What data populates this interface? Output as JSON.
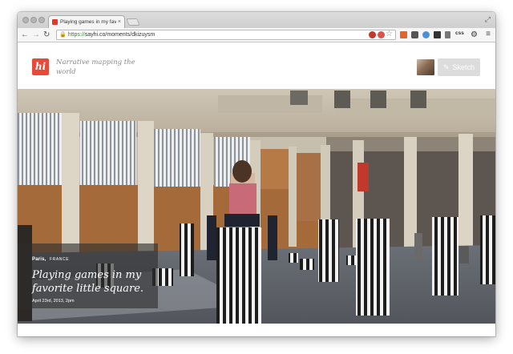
{
  "browser": {
    "tab_title": "Playing games in my favo",
    "tab_close": "×",
    "url_scheme": "https://",
    "url_rest": "sayhi.co/moments/dkizuysm",
    "ext_label": "css"
  },
  "site": {
    "logo_text": "hi",
    "tagline": "Narrative mapping the world",
    "sketch_label": "Sketch"
  },
  "moment": {
    "place": "Paris,",
    "country": "FRANCE",
    "title": "Playing games in my favorite little square.",
    "date": "April 23rd, 2013, 2pm"
  },
  "colors": {
    "brand": "#e84a3a",
    "sketch_button": "#dcdcdc",
    "url_green": "#2a8a2a"
  }
}
